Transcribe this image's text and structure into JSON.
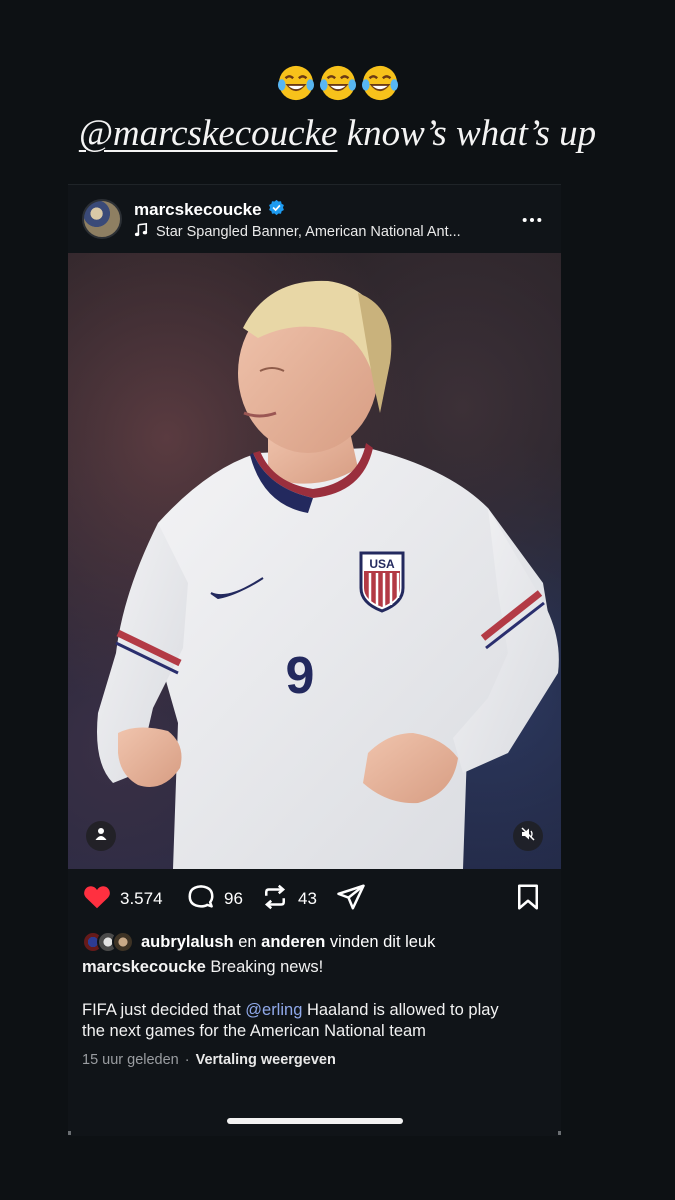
{
  "story": {
    "emoji": [
      "😂",
      "😂",
      "😂"
    ],
    "mention": "@marcskecoucke",
    "caption_rest": " know’s what’s up"
  },
  "post": {
    "username": "marcskecoucke",
    "music": "Star Spangled Banner, American National Ant...",
    "jersey": {
      "brand_text": "USA",
      "number": "9"
    },
    "likes_count": "3.574",
    "comments_count": "96",
    "reposts_count": "43",
    "liked_by_user": "aubrylalush",
    "liked_by_joiner": " en ",
    "liked_by_others": "anderen",
    "liked_by_tail": " vinden dit leuk",
    "caption_user": "marcskecoucke",
    "caption_first": " Breaking news!",
    "caption_l2_a": "FIFA just decided that ",
    "caption_l2_link": "@erling",
    "caption_l2_b": " Haaland is allowed to play",
    "caption_l3": "the next games for the American National team",
    "time_ago": "15 uur geleden",
    "dot": "·",
    "translate": "Vertaling weergeven"
  },
  "colors": {
    "like": "#ff3040",
    "link": "#90a9ea",
    "verified": "#1d9bf0",
    "background": "#0d1114"
  }
}
